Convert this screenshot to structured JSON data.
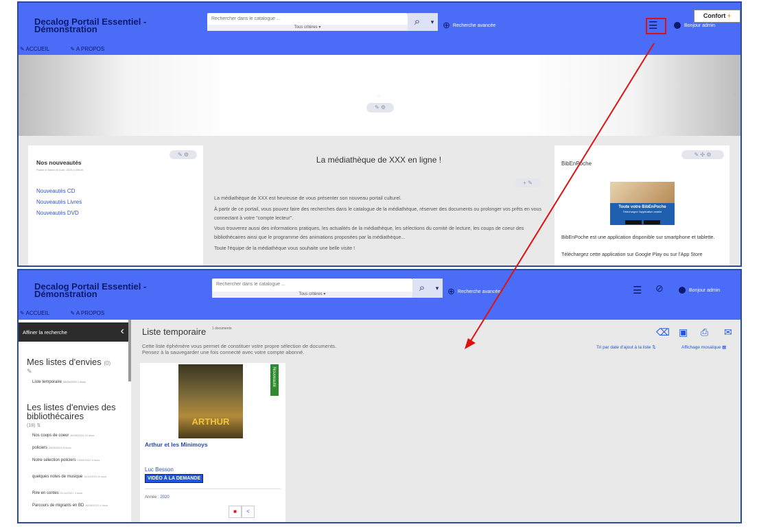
{
  "comfort_badge": {
    "label": "Confort",
    "icon": "plus-icon",
    "color": "#f29a1c"
  },
  "top": {
    "site_title": "Decalog Portail Essentiel - Démonstration",
    "search": {
      "placeholder": "Rechercher dans le catalogue ...",
      "criteria": "Tous critères ▾"
    },
    "advanced_search": "Recherche avancée",
    "user_greeting": "Bonjour admin",
    "nav": [
      "ACCUEIL",
      "A PROPOS"
    ],
    "carousel_dot": "-",
    "news": {
      "title": "Nos nouveautés",
      "meta": "Publié le Mardi 05 Août, 2025 à 09h08",
      "links": [
        "Nouveautés CD",
        "Nouveautés Livres",
        "Nouveautés DVD"
      ]
    },
    "welcome": {
      "title": "La médiathèque de XXX en ligne !",
      "p1": "La médiathèque de XXX est heureuse de vous présenter son nouveau portail culturel.",
      "p2": "À partir de ce portail, vous pouvez faire des recherches dans le catalogue de la médiathèque, réserver des documents ou prolonger vos prêts en vous connectant à votre \"compte lecteur\".",
      "p3": "Vous trouverez aussi des informations pratiques, les actualités de la médiathèque, les sélections du comité de lecture, les coups de coeur des bibliothécaires ainsi que le programme des animations proposées par la médiathèque...",
      "p4": "Toute l'équipe de la médiathèque vous souhaite une belle visite !"
    },
    "bib": {
      "title": "BibEnPoche",
      "promo_line1": "Toute votre BibEnPoche",
      "promo_line2": "Téléchargez l'application mobile",
      "desc": "BibEnPoche est une application disponible sur smartphone et tablette.",
      "download": "Téléchargez cette application sur Google Play ou sur l'App Store"
    }
  },
  "bottom": {
    "site_title": "Decalog Portail Essentiel - Démonstration",
    "search": {
      "placeholder": "Rechercher dans le catalogue ...",
      "criteria": "Tous critères ▾"
    },
    "advanced_search": "Recherche avancée",
    "user_greeting": "Bonjour admin",
    "nav": [
      "ACCUEIL",
      "A PROPOS"
    ],
    "sidebar": {
      "header": "Affiner la recherche",
      "my_lists_title": "Mes listes d'envies",
      "my_lists_count": "(0)",
      "temp_list": "Liste temporaire",
      "temp_list_meta": "05/08/2025 1 docs",
      "librarian_title": "Les listes d'envies des bibliothécaires",
      "librarian_count": "(18)",
      "lists": [
        {
          "name": "Nos coups de coeur",
          "meta": "18/06/2024 13 docs"
        },
        {
          "name": "policiers",
          "meta": "23/06/2023 6 docs"
        },
        {
          "name": "Notre sélection policiers",
          "meta": "19/05/2022 8 docs"
        },
        {
          "name": "quelques notes de musique",
          "meta": "14/12/2021 8 docs"
        },
        {
          "name": "Rire en contes",
          "meta": "01/10/2021 3 docs"
        },
        {
          "name": "Parcours de migrants en BD",
          "meta": "16/09/2021 4 docs"
        }
      ]
    },
    "list_title": "Liste temporaire",
    "doc_count": "1 documents",
    "desc_line1": "Cette liste éphémère vous permet de constituer votre propre sélection de documents.",
    "desc_line2": "Pensez à la sauvegarder une fois connecté avec votre compte abonné.",
    "sort_label": "Tri par date d'ajout à la liste",
    "display_label": "Affichage mosaïque",
    "item": {
      "ribbon": "Nouveauté",
      "poster_text": "ARTHUR",
      "title": "Arthur et les Minimoys",
      "author": "Luc Besson",
      "badge": "VIDÉO À LA DEMANDE",
      "year_label": "Année :",
      "year": "2020"
    }
  },
  "colors": {
    "header": "#4a6cf7",
    "annotation": "#e01010",
    "primary": "#1f55e0"
  }
}
